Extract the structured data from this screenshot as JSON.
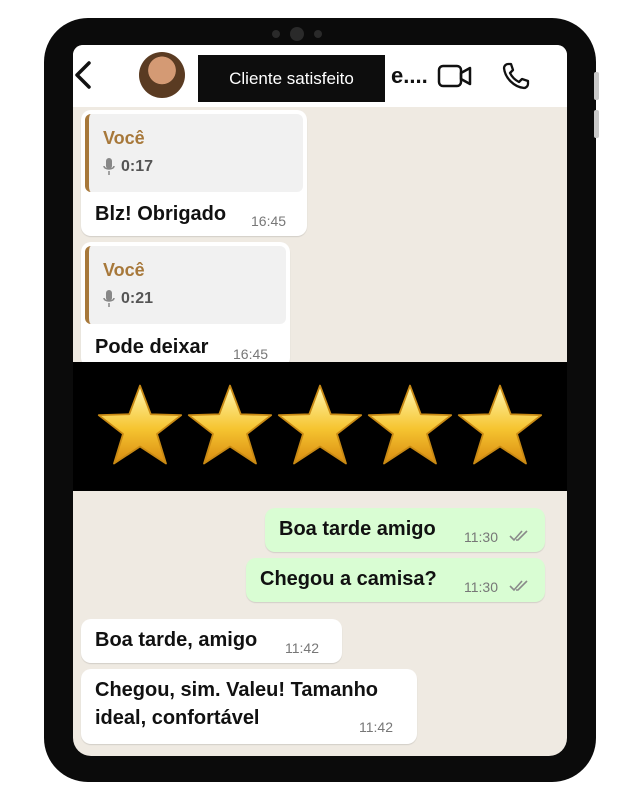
{
  "header": {
    "contact_name": "e....",
    "caption": "Cliente satisfeito"
  },
  "messages": [
    {
      "direction": "in",
      "quote_author": "Você",
      "quote_duration": "0:17",
      "text": "Blz! Obrigado",
      "time": "16:45"
    },
    {
      "direction": "in",
      "quote_author": "Você",
      "quote_duration": "0:21",
      "text": "Pode deixar",
      "time": "16:45"
    },
    {
      "direction": "out",
      "text": "Boa tarde amigo",
      "time": "11:30",
      "status": "read"
    },
    {
      "direction": "out",
      "text": "Chegou a camisa?",
      "time": "11:30",
      "status": "read"
    },
    {
      "direction": "in",
      "text": "Boa tarde, amigo",
      "time": "11:42"
    },
    {
      "direction": "in",
      "text_line1": "Chegou, sim. Valeu! Tamanho",
      "text_line2": "ideal, confortável",
      "time": "11:42"
    }
  ],
  "rating": {
    "stars": 5,
    "max": 5
  },
  "icons": [
    "back-arrow-icon",
    "video-call-icon",
    "phone-icon",
    "mic-icon",
    "double-check-icon",
    "star-icon"
  ],
  "colors": {
    "outgoing_bubble": "#d9fdd3",
    "quote_accent": "#a7783a",
    "chat_background": "#efeae2"
  }
}
